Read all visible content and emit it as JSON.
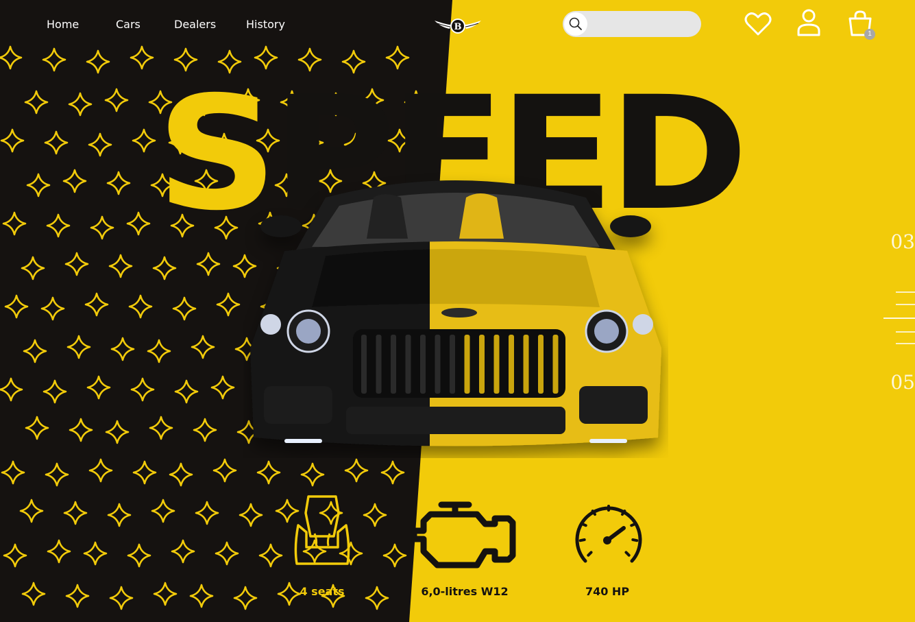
{
  "nav": {
    "items": [
      {
        "label": "Home"
      },
      {
        "label": "Cars"
      },
      {
        "label": "Dealers"
      },
      {
        "label": "History"
      }
    ]
  },
  "logo": {
    "letter": "B"
  },
  "search": {
    "placeholder": "",
    "value": "",
    "icon": "search-icon"
  },
  "header_icons": {
    "favorites": "heart-icon",
    "account": "user-icon",
    "cart": "shopping-bag-icon",
    "cart_count": "1"
  },
  "hero": {
    "title_yellow": "S",
    "title_dark": "PEED"
  },
  "slider": {
    "current": "03",
    "next": "05"
  },
  "features": [
    {
      "icon": "car-seat-icon",
      "label": "4 seats"
    },
    {
      "icon": "engine-icon",
      "label": "6,0-litres W12"
    },
    {
      "icon": "speedometer-icon",
      "label": "740 HP"
    }
  ],
  "colors": {
    "accent": "#f2cb0a",
    "dark": "#151210",
    "light": "#ffffff"
  }
}
